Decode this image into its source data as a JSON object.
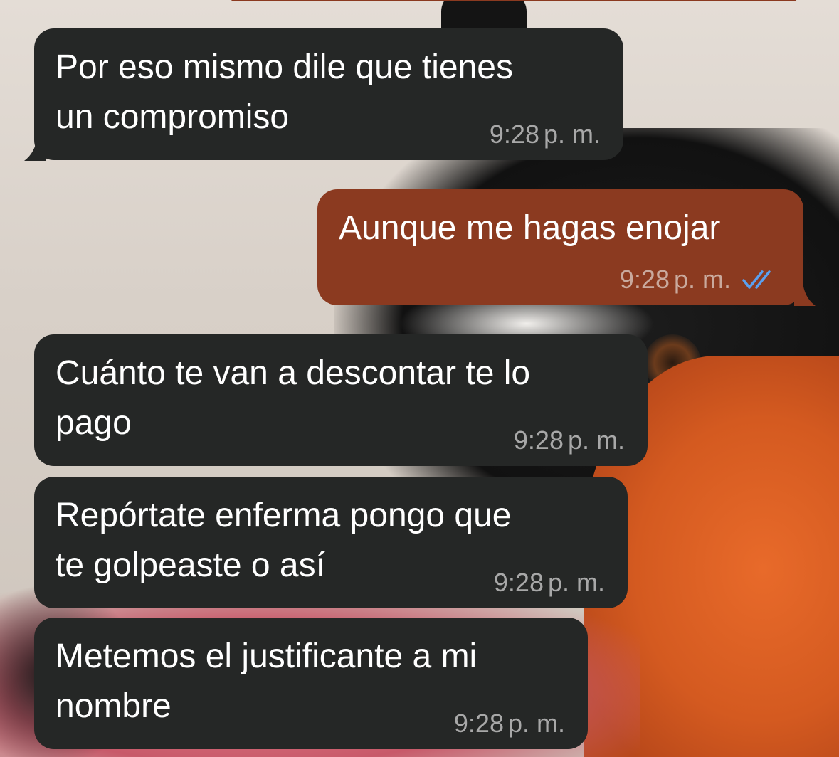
{
  "conversation": {
    "messages": [
      {
        "id": "m1",
        "direction": "incoming",
        "text": "Por eso mismo dile que tienes\nun compromiso",
        "time": "9:28",
        "ampm": "p. m."
      },
      {
        "id": "m2",
        "direction": "outgoing",
        "text": "Aunque me hagas enojar",
        "time": "9:28",
        "ampm": "p. m.",
        "status": "read"
      },
      {
        "id": "m3",
        "direction": "incoming",
        "text": "Cuánto te van a descontar te lo\npago",
        "time": "9:28",
        "ampm": "p. m."
      },
      {
        "id": "m4",
        "direction": "incoming",
        "text": "Repórtate enferma pongo que\nte golpeaste o así",
        "time": "9:28",
        "ampm": "p. m."
      },
      {
        "id": "m5",
        "direction": "incoming",
        "text": "Metemos el justificante a mi\nnombre",
        "time": "9:28",
        "ampm": "p. m."
      }
    ]
  },
  "colors": {
    "incoming_bubble": "#252726",
    "outgoing_bubble": "#8b3a20",
    "read_tick": "#5aa0f0"
  },
  "icons": {
    "read_receipt": "double-check-icon"
  }
}
